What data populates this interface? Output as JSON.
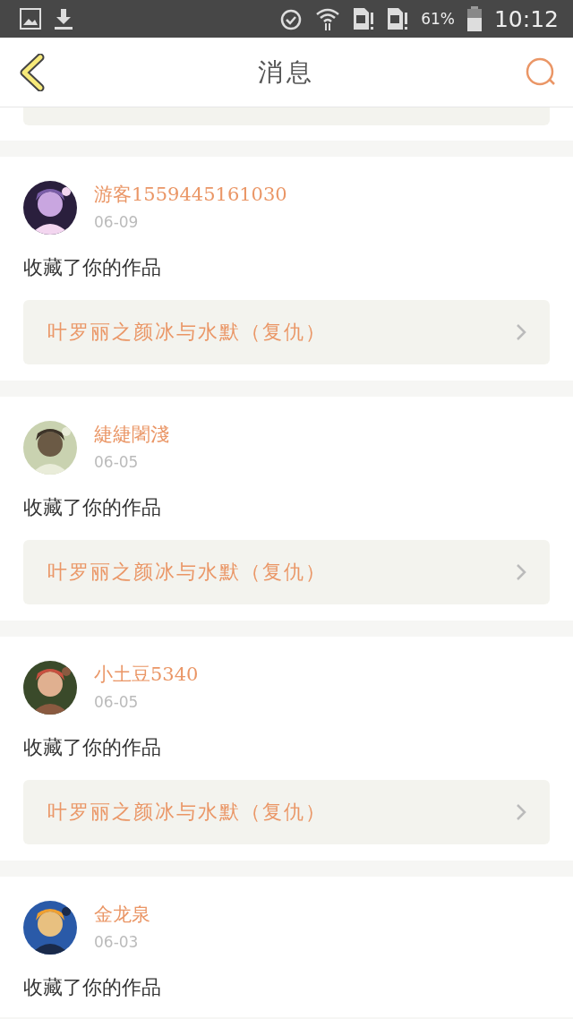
{
  "status_bar": {
    "battery": "61%",
    "time": "10:12"
  },
  "header": {
    "title": "消息"
  },
  "messages": [
    {
      "user": "游客1559445161030",
      "date": "06-09",
      "action": "收藏了你的作品",
      "work": "叶罗丽之颜冰与水默（复仇）"
    },
    {
      "user": "緁緁闍淺",
      "date": "06-05",
      "action": "收藏了你的作品",
      "work": "叶罗丽之颜冰与水默（复仇）"
    },
    {
      "user": "小土豆5340",
      "date": "06-05",
      "action": "收藏了你的作品",
      "work": "叶罗丽之颜冰与水默（复仇）"
    },
    {
      "user": "金龙泉",
      "date": "06-03",
      "action": "收藏了你的作品"
    }
  ]
}
